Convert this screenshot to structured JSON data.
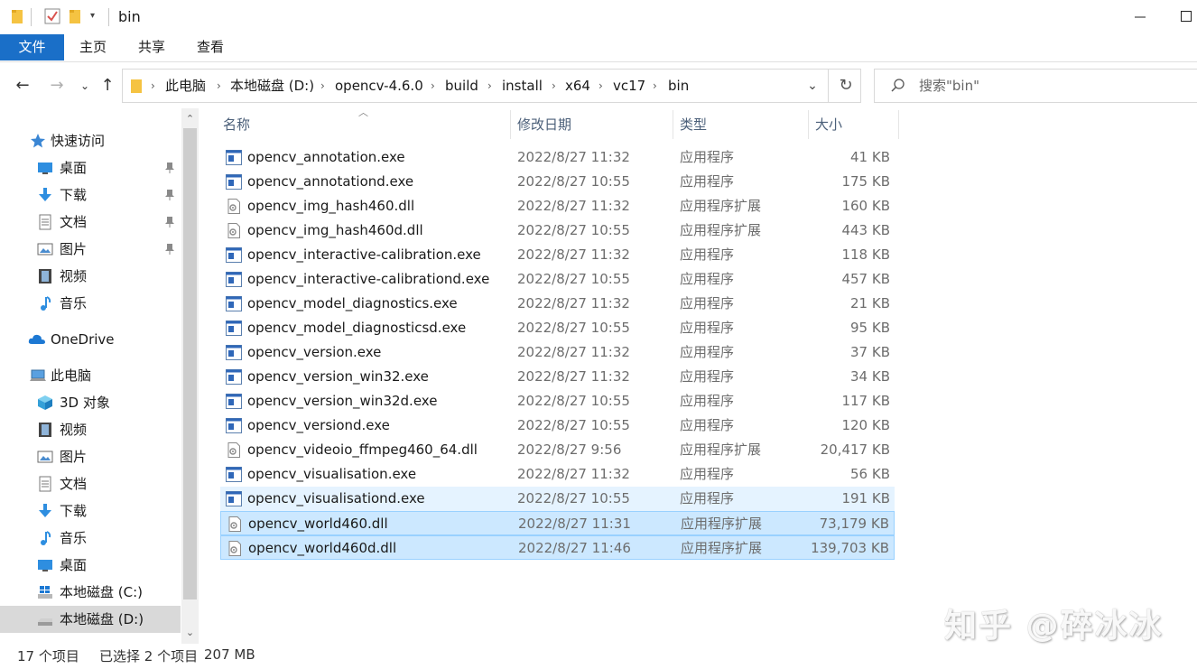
{
  "window": {
    "title": "bin"
  },
  "ribbon": {
    "tabs": [
      "文件",
      "主页",
      "共享",
      "查看"
    ]
  },
  "address": {
    "crumbs": [
      "此电脑",
      "本地磁盘 (D:)",
      "opencv-4.6.0",
      "build",
      "install",
      "x64",
      "vc17",
      "bin"
    ]
  },
  "search": {
    "placeholder": "搜索\"bin\""
  },
  "nav_pane": {
    "items": [
      {
        "label": "快速访问",
        "icon": "star-icon"
      },
      {
        "label": "桌面",
        "icon": "desktop-icon",
        "pinned": true
      },
      {
        "label": "下载",
        "icon": "download-icon",
        "pinned": true
      },
      {
        "label": "文档",
        "icon": "document-icon",
        "pinned": true
      },
      {
        "label": "图片",
        "icon": "picture-icon",
        "pinned": true
      },
      {
        "label": "视频",
        "icon": "video-icon"
      },
      {
        "label": "音乐",
        "icon": "music-icon"
      },
      {
        "label": "OneDrive",
        "icon": "cloud-icon"
      },
      {
        "label": "此电脑",
        "icon": "computer-icon"
      },
      {
        "label": "3D 对象",
        "icon": "cube-icon"
      },
      {
        "label": "视频",
        "icon": "video-icon"
      },
      {
        "label": "图片",
        "icon": "picture-icon"
      },
      {
        "label": "文档",
        "icon": "document-icon"
      },
      {
        "label": "下载",
        "icon": "download-icon"
      },
      {
        "label": "音乐",
        "icon": "music-icon"
      },
      {
        "label": "桌面",
        "icon": "desktop-icon"
      },
      {
        "label": "本地磁盘 (C:)",
        "icon": "windows-drive-icon"
      },
      {
        "label": "本地磁盘 (D:)",
        "icon": "drive-icon",
        "selected": true
      }
    ]
  },
  "file_list": {
    "columns": [
      "名称",
      "修改日期",
      "类型",
      "大小"
    ],
    "files": [
      {
        "name": "opencv_annotation.exe",
        "date": "2022/8/27 11:32",
        "type": "应用程序",
        "size": "41 KB",
        "kind": "exe"
      },
      {
        "name": "opencv_annotationd.exe",
        "date": "2022/8/27 10:55",
        "type": "应用程序",
        "size": "175 KB",
        "kind": "exe"
      },
      {
        "name": "opencv_img_hash460.dll",
        "date": "2022/8/27 11:32",
        "type": "应用程序扩展",
        "size": "160 KB",
        "kind": "dll"
      },
      {
        "name": "opencv_img_hash460d.dll",
        "date": "2022/8/27 10:55",
        "type": "应用程序扩展",
        "size": "443 KB",
        "kind": "dll"
      },
      {
        "name": "opencv_interactive-calibration.exe",
        "date": "2022/8/27 11:32",
        "type": "应用程序",
        "size": "118 KB",
        "kind": "exe"
      },
      {
        "name": "opencv_interactive-calibrationd.exe",
        "date": "2022/8/27 10:55",
        "type": "应用程序",
        "size": "457 KB",
        "kind": "exe"
      },
      {
        "name": "opencv_model_diagnostics.exe",
        "date": "2022/8/27 11:32",
        "type": "应用程序",
        "size": "21 KB",
        "kind": "exe"
      },
      {
        "name": "opencv_model_diagnosticsd.exe",
        "date": "2022/8/27 10:55",
        "type": "应用程序",
        "size": "95 KB",
        "kind": "exe"
      },
      {
        "name": "opencv_version.exe",
        "date": "2022/8/27 11:32",
        "type": "应用程序",
        "size": "37 KB",
        "kind": "exe"
      },
      {
        "name": "opencv_version_win32.exe",
        "date": "2022/8/27 11:32",
        "type": "应用程序",
        "size": "34 KB",
        "kind": "exe"
      },
      {
        "name": "opencv_version_win32d.exe",
        "date": "2022/8/27 10:55",
        "type": "应用程序",
        "size": "117 KB",
        "kind": "exe"
      },
      {
        "name": "opencv_versiond.exe",
        "date": "2022/8/27 10:55",
        "type": "应用程序",
        "size": "120 KB",
        "kind": "exe"
      },
      {
        "name": "opencv_videoio_ffmpeg460_64.dll",
        "date": "2022/8/27 9:56",
        "type": "应用程序扩展",
        "size": "20,417 KB",
        "kind": "dll"
      },
      {
        "name": "opencv_visualisation.exe",
        "date": "2022/8/27 11:32",
        "type": "应用程序",
        "size": "56 KB",
        "kind": "exe"
      },
      {
        "name": "opencv_visualisationd.exe",
        "date": "2022/8/27 10:55",
        "type": "应用程序",
        "size": "191 KB",
        "kind": "exe",
        "state": "hover"
      },
      {
        "name": "opencv_world460.dll",
        "date": "2022/8/27 11:31",
        "type": "应用程序扩展",
        "size": "73,179 KB",
        "kind": "dll",
        "state": "selected"
      },
      {
        "name": "opencv_world460d.dll",
        "date": "2022/8/27 11:46",
        "type": "应用程序扩展",
        "size": "139,703 KB",
        "kind": "dll",
        "state": "selected"
      }
    ]
  },
  "status_bar": {
    "item_count": "17 个项目",
    "selection": "已选择 2 个项目",
    "selection_size": "207 MB"
  },
  "watermark": "知乎 @碎冰冰",
  "colors": {
    "accent": "#1a6fc8",
    "selected_bg": "#cce8ff",
    "hover_bg": "#e5f3ff",
    "folder": "#f5c342"
  }
}
